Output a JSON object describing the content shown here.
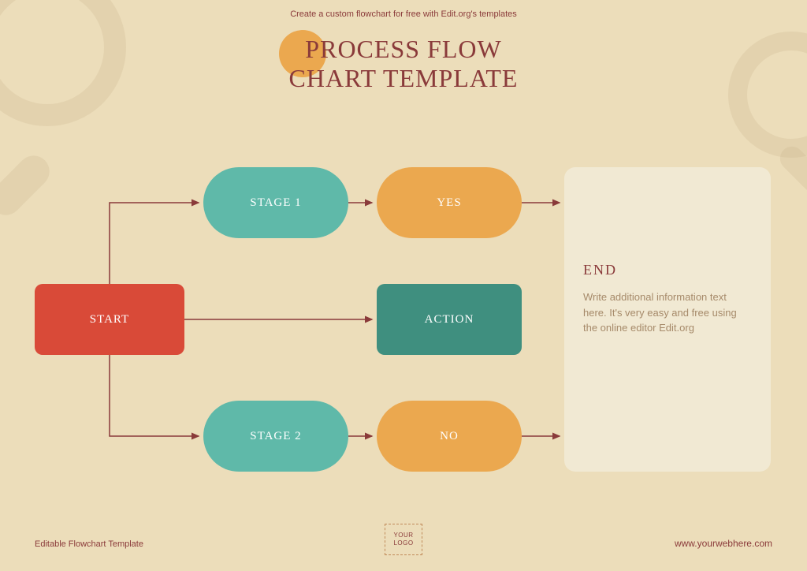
{
  "tagline": "Create a custom flowchart for free with Edit.org's templates",
  "title_line1": "PROCESS FLOW",
  "title_line2": "CHART TEMPLATE",
  "nodes": {
    "start": "START",
    "stage1": "STAGE 1",
    "yes": "YES",
    "action": "ACTION",
    "stage2": "STAGE 2",
    "no": "NO"
  },
  "endbox": {
    "heading": "END",
    "body": "Write additional information text here. It's very easy and free using the online editor Edit.org"
  },
  "footer": {
    "left": "Editable Flowchart Template",
    "logo_line1": "YOUR",
    "logo_line2": "LOGO",
    "right": "www.yourwebhere.com"
  },
  "colors": {
    "bg": "#ecddba",
    "accent": "#8a3a3a",
    "red": "#d94a38",
    "teal": "#5fb9a9",
    "darkteal": "#3f8f7f",
    "orange": "#eba84f"
  }
}
